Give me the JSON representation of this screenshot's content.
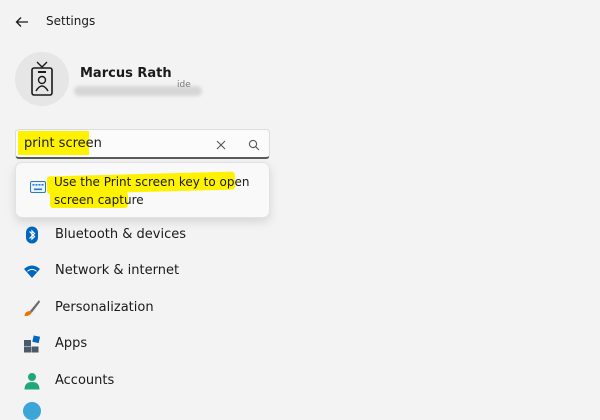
{
  "window": {
    "title": "Settings"
  },
  "user": {
    "name": "Marcus Rath",
    "email_tail": "ide"
  },
  "search": {
    "query": "print screen"
  },
  "suggestion": {
    "text": "Use the Print screen key to open screen capture"
  },
  "nav": {
    "items": [
      {
        "label": "Bluetooth & devices",
        "icon": "bluetooth-icon"
      },
      {
        "label": "Network & internet",
        "icon": "wifi-icon"
      },
      {
        "label": "Personalization",
        "icon": "brush-icon"
      },
      {
        "label": "Apps",
        "icon": "apps-icon"
      },
      {
        "label": "Accounts",
        "icon": "person-icon"
      }
    ]
  },
  "colors": {
    "highlight": "#fff200",
    "accent": "#0067c0",
    "background": "#f3f3f3"
  }
}
